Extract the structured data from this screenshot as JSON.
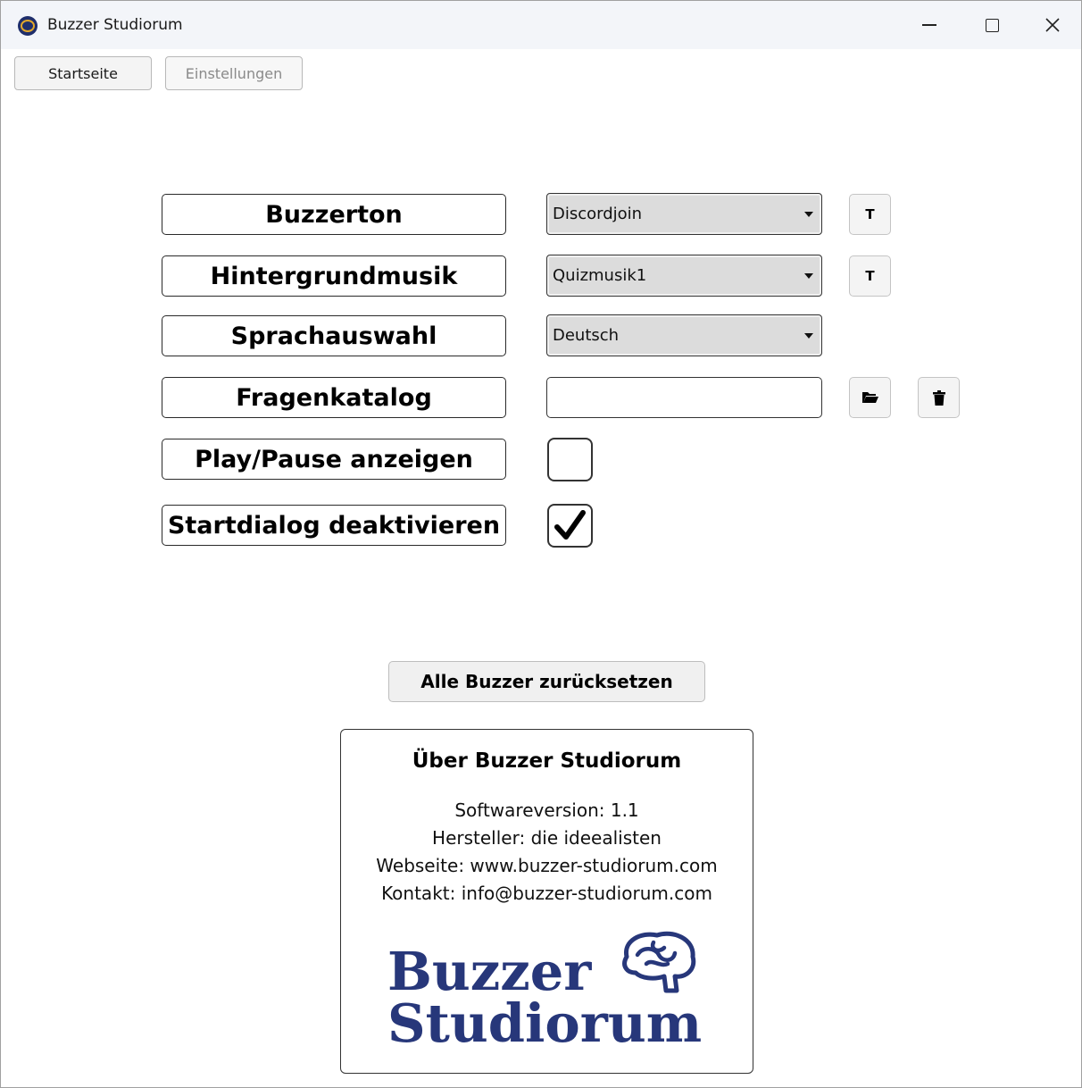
{
  "window": {
    "title": "Buzzer Studiorum"
  },
  "nav": {
    "home_label": "Startseite",
    "settings_label": "Einstellungen"
  },
  "settings": {
    "buzzer_tone": {
      "label": "Buzzerton",
      "value": "Discordjoin",
      "test_label": "T"
    },
    "background_music": {
      "label": "Hintergrundmusik",
      "value": "Quizmusik1",
      "test_label": "T"
    },
    "language": {
      "label": "Sprachauswahl",
      "value": "Deutsch"
    },
    "question_catalog": {
      "label": "Fragenkatalog",
      "value": ""
    },
    "show_play_pause": {
      "label": "Play/Pause anzeigen",
      "checked": false
    },
    "disable_start_dialog": {
      "label": "Startdialog deaktivieren",
      "checked": true
    }
  },
  "reset_label": "Alle Buzzer zurücksetzen",
  "about": {
    "title": "Über Buzzer Studiorum",
    "version": "Softwareversion: 1.1",
    "manufacturer": "Hersteller: die ideealisten",
    "website": "Webseite: www.buzzer-studiorum.com",
    "contact": "Kontakt: info@buzzer-studiorum.com",
    "logo_line1": "Buzzer",
    "logo_line2": "Studiorum"
  },
  "colors": {
    "logo": "#27377a",
    "disabled_text": "#8a8a8a"
  },
  "icons": {
    "app": "app-logo-icon",
    "minimize": "minimize-icon",
    "maximize": "maximize-icon",
    "close": "close-icon",
    "folder": "folder-open-icon",
    "trash": "trash-icon",
    "check": "checkmark-icon",
    "brain": "brain-icon"
  }
}
